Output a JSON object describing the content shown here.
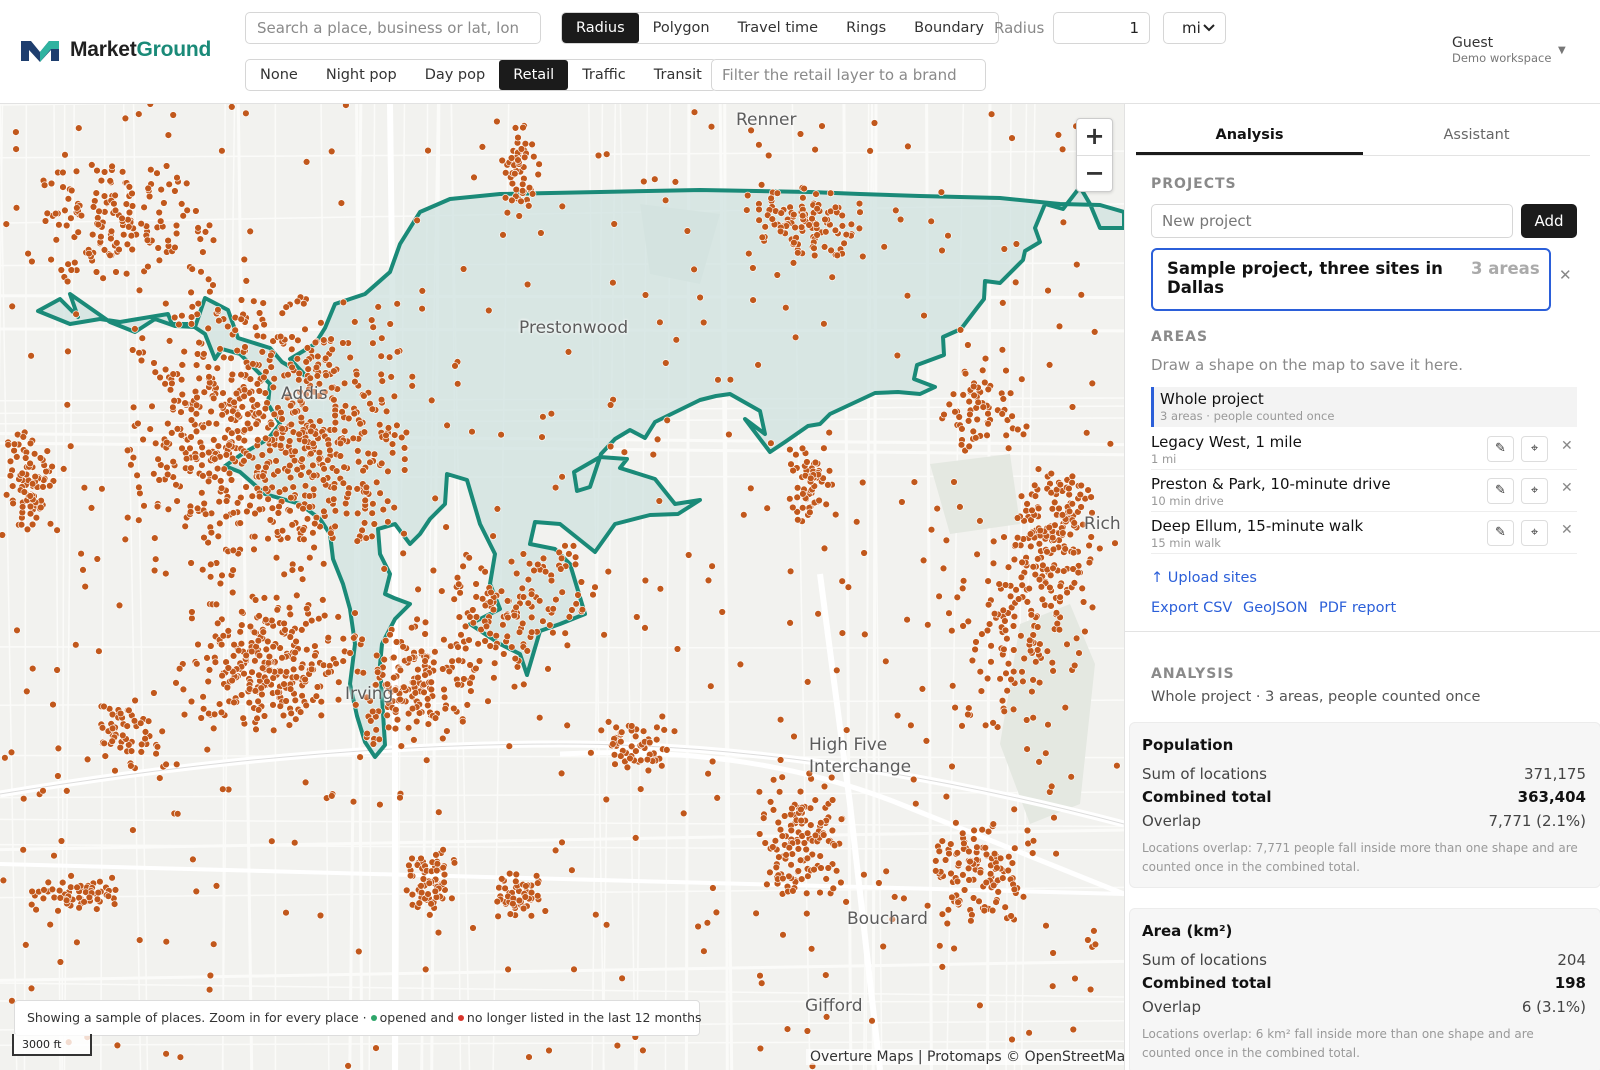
{
  "app": {
    "logo_part1": "Market",
    "logo_part2": "Ground",
    "accent_color": "#1a8a78",
    "selection_color": "#2b5fd9"
  },
  "toolbar": {
    "search_placeholder": "Search a place, business or lat, lon",
    "modes": [
      "Radius",
      "Polygon",
      "Travel time",
      "Rings",
      "Boundary"
    ],
    "active_mode": "Radius",
    "radius_label": "Radius",
    "radius_value": "1",
    "unit": "mi",
    "layers": [
      "None",
      "Night pop",
      "Day pop",
      "Retail",
      "Traffic",
      "Transit"
    ],
    "active_layer": "Retail",
    "brand_filter_placeholder": "Filter the retail layer to a brand"
  },
  "user": {
    "name": "Guest",
    "workspace": "Demo workspace"
  },
  "map": {
    "labels": [
      "Renner",
      "Prestonwood",
      "Addis",
      "Rich",
      "High Five Interchange",
      "Irving",
      "Bouchard",
      "Gifford"
    ],
    "zoom_in": "+",
    "zoom_out": "−",
    "legend_text": "Showing a sample of places. Zoom in for every place ·",
    "legend_opened": "opened and",
    "legend_closed": "no longer listed in the last 12 months",
    "opened_color": "#2ea66a",
    "closed_color": "#d9352b",
    "scale": "3000 ft",
    "attribution": "Overture Maps | Protomaps © OpenStreetMap",
    "place_color": "#c1581c",
    "area_outline_color": "#1a8a78"
  },
  "sidebar": {
    "tabs": [
      "Analysis",
      "Assistant"
    ],
    "active_tab": "Analysis",
    "projects_title": "PROJECTS",
    "new_project_placeholder": "New project",
    "add_label": "Add",
    "project": {
      "name": "Sample project, three sites in Dallas",
      "count": "3 areas"
    },
    "areas_title": "AREAS",
    "areas_hint": "Draw a shape on the map to save it here.",
    "areas": [
      {
        "name": "Whole project",
        "sub": "3 areas · people counted once"
      },
      {
        "name": "Legacy West, 1 mile",
        "sub": "1 mi"
      },
      {
        "name": "Preston & Park, 10-minute drive",
        "sub": "10 min drive"
      },
      {
        "name": "Deep Ellum, 15-minute walk",
        "sub": "15 min walk"
      }
    ],
    "upload_sites": "↑ Upload sites",
    "export_csv": "Export CSV",
    "geojson": "GeoJSON",
    "pdf_report": "PDF report",
    "analysis_title": "ANALYSIS",
    "analysis_sub": "Whole project · 3 areas, people counted once",
    "population": {
      "title": "Population",
      "rows": [
        {
          "label": "Sum of locations",
          "value": "371,175"
        },
        {
          "label": "Combined total",
          "value": "363,404"
        },
        {
          "label": "Overlap",
          "value": "7,771 (2.1%)"
        }
      ],
      "note": "Locations overlap: 7,771 people fall inside more than one shape and are counted once in the combined total."
    },
    "area_km": {
      "title": "Area (km²)",
      "rows": [
        {
          "label": "Sum of locations",
          "value": "204"
        },
        {
          "label": "Combined total",
          "value": "198"
        },
        {
          "label": "Overlap",
          "value": "6 (3.1%)"
        }
      ],
      "note": "Locations overlap: 6 km² fall inside more than one shape and are counted once in the combined total."
    }
  }
}
